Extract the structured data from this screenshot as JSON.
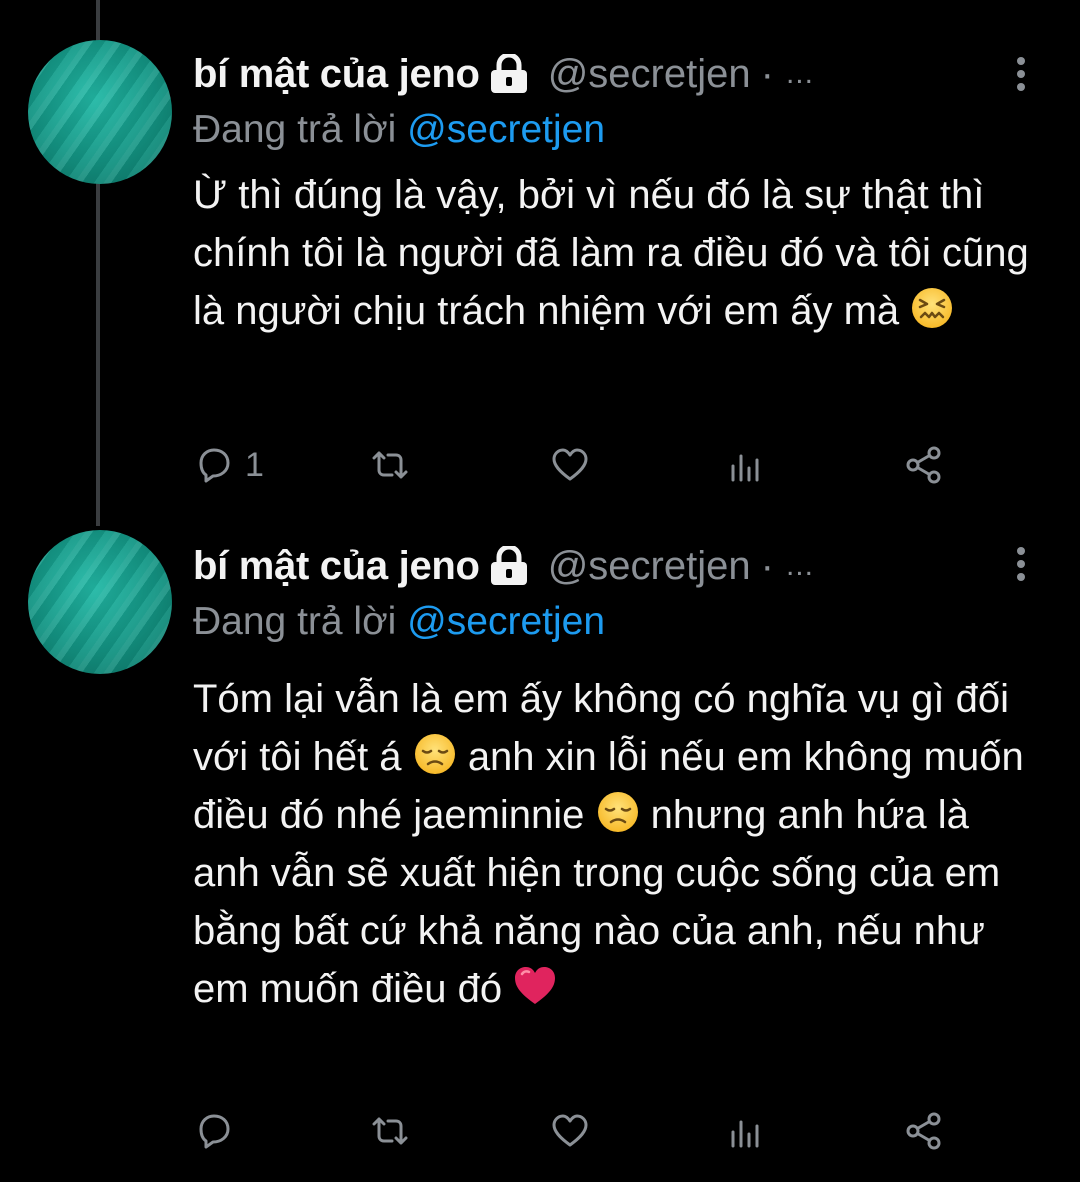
{
  "colors": {
    "background": "#000000",
    "text": "#f3f3f3",
    "muted": "#8b9096",
    "mention": "#1d9bf0",
    "avatar": "#139584",
    "thread_line": "#3a3d40"
  },
  "tweets": [
    {
      "author": {
        "display_name": "bí mật của jeno",
        "protected_icon": "lock-icon",
        "handle": "@secretjen",
        "separator": "·",
        "truncation": "..."
      },
      "replying": {
        "prefix": "Đang trả lời",
        "mention": "@secretjen"
      },
      "text_parts": [
        "Ừ thì đúng là vậy, bởi vì nếu đó là sự thật thì chính tôi là người đã làm ra điều đó và tôi cũng là người chịu trách nhiệm với em ấy mà"
      ],
      "emojis": [
        "confounded-face-emoji"
      ],
      "actions": {
        "reply_count": "1",
        "retweet_count": "",
        "like_count": ""
      }
    },
    {
      "author": {
        "display_name": "bí mật của jeno",
        "protected_icon": "lock-icon",
        "handle": "@secretjen",
        "separator": "·",
        "truncation": "..."
      },
      "replying": {
        "prefix": "Đang trả lời",
        "mention": "@secretjen"
      },
      "text_parts": [
        "Tóm lại vẫn là em ấy không có nghĩa vụ gì đối với tôi hết á",
        "anh xin lỗi nếu em không muốn điều đó nhé jaeminnie",
        "nhưng anh hứa là anh vẫn sẽ xuất hiện trong cuộc sống của em bằng bất cứ khả năng nào của anh, nếu như em muốn điều đó"
      ],
      "emojis": [
        "disappointed-face-emoji",
        "disappointed-face-emoji",
        "red-heart-emoji"
      ],
      "actions": {
        "reply_count": "",
        "retweet_count": "",
        "like_count": ""
      }
    }
  ]
}
